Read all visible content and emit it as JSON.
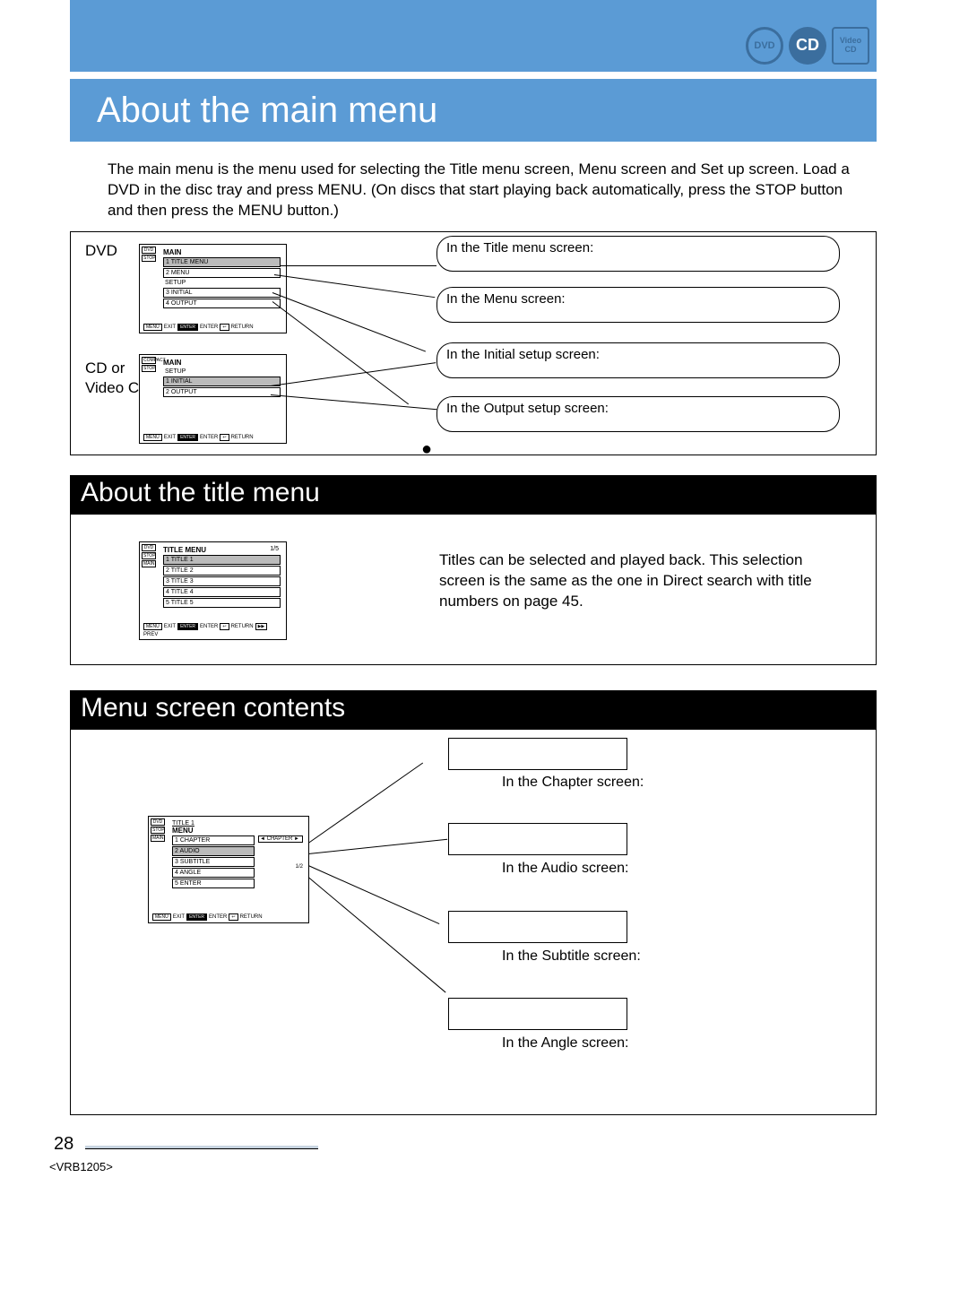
{
  "logos": {
    "dvd": "DVD",
    "cd": "CD",
    "vcd_top": "Video",
    "vcd_bot": "CD"
  },
  "page_title": "About the main menu",
  "intro": "The main menu is the menu used for selecting the Title menu screen, Menu screen and Set up screen. Load a DVD in the disc tray and press MENU. (On discs that start playing back automatically, press the STOP button and then press the MENU button.)",
  "dvd_label": "DVD",
  "cd_label": "CD or\nVideo CD",
  "screen1": {
    "side1": "DVD",
    "side2": "STOP",
    "title": "MAIN",
    "rows": [
      "1 TITLE MENU",
      "2 MENU"
    ],
    "group": "SETUP",
    "rows2": [
      "3 INITIAL",
      "4 OUTPUT"
    ],
    "foot": [
      "MENU",
      "EXIT",
      "ENTER",
      "ENTER",
      "↩",
      "RETURN"
    ]
  },
  "screen2": {
    "side1": "COMPACT",
    "side2": "STOP",
    "title": "MAIN",
    "group": "SETUP",
    "rows": [
      "1 INITIAL",
      "2 OUTPUT"
    ],
    "foot": [
      "MENU",
      "EXIT",
      "ENTER",
      "ENTER",
      "↩",
      "RETURN"
    ]
  },
  "callouts": {
    "c1": "In the Title menu screen:",
    "c2": "In the Menu screen:",
    "c3": "In the Initial setup screen:",
    "c4": "In the Output setup screen:"
  },
  "sec2_title": "About the title menu",
  "screen3": {
    "side1": "DVD",
    "side2": "STOP",
    "side3": "MAIN",
    "title": "TITLE MENU",
    "page": "1/5",
    "rows": [
      "1 TITLE 1",
      "2 TITLE 2",
      "3 TITLE 3",
      "4 TITLE 4",
      "5 TITLE 5"
    ],
    "foot": [
      "MENU",
      "EXIT",
      "ENTER",
      "ENTER",
      "↩",
      "RETURN",
      "▶▶",
      "PREV"
    ]
  },
  "para2": "Titles can be selected and played back. This selection screen is the same as the one in  Direct search with title numbers  on page 45.",
  "sec3_title": "Menu screen contents",
  "screen4": {
    "side1": "DVD",
    "side2": "STOP",
    "side3": "MAIN",
    "top": "TITLE 1",
    "title": "MENU",
    "rows": [
      "1 CHAPTER",
      "2 AUDIO",
      "3 SUBTITLE",
      "4 ANGLE",
      "5 ENTER"
    ],
    "right": "◄ CHAPTER ►",
    "r_angle": "1/2",
    "foot": [
      "MENU",
      "EXIT",
      "ENTER",
      "ENTER",
      "↩",
      "RETURN"
    ]
  },
  "screen_labels": {
    "chapter": "In the Chapter screen:",
    "audio": "In the Audio screen:",
    "subtitle": "In the Subtitle screen:",
    "angle": "In the Angle screen:"
  },
  "page_number": "28",
  "doc_id": "<VRB1205>"
}
